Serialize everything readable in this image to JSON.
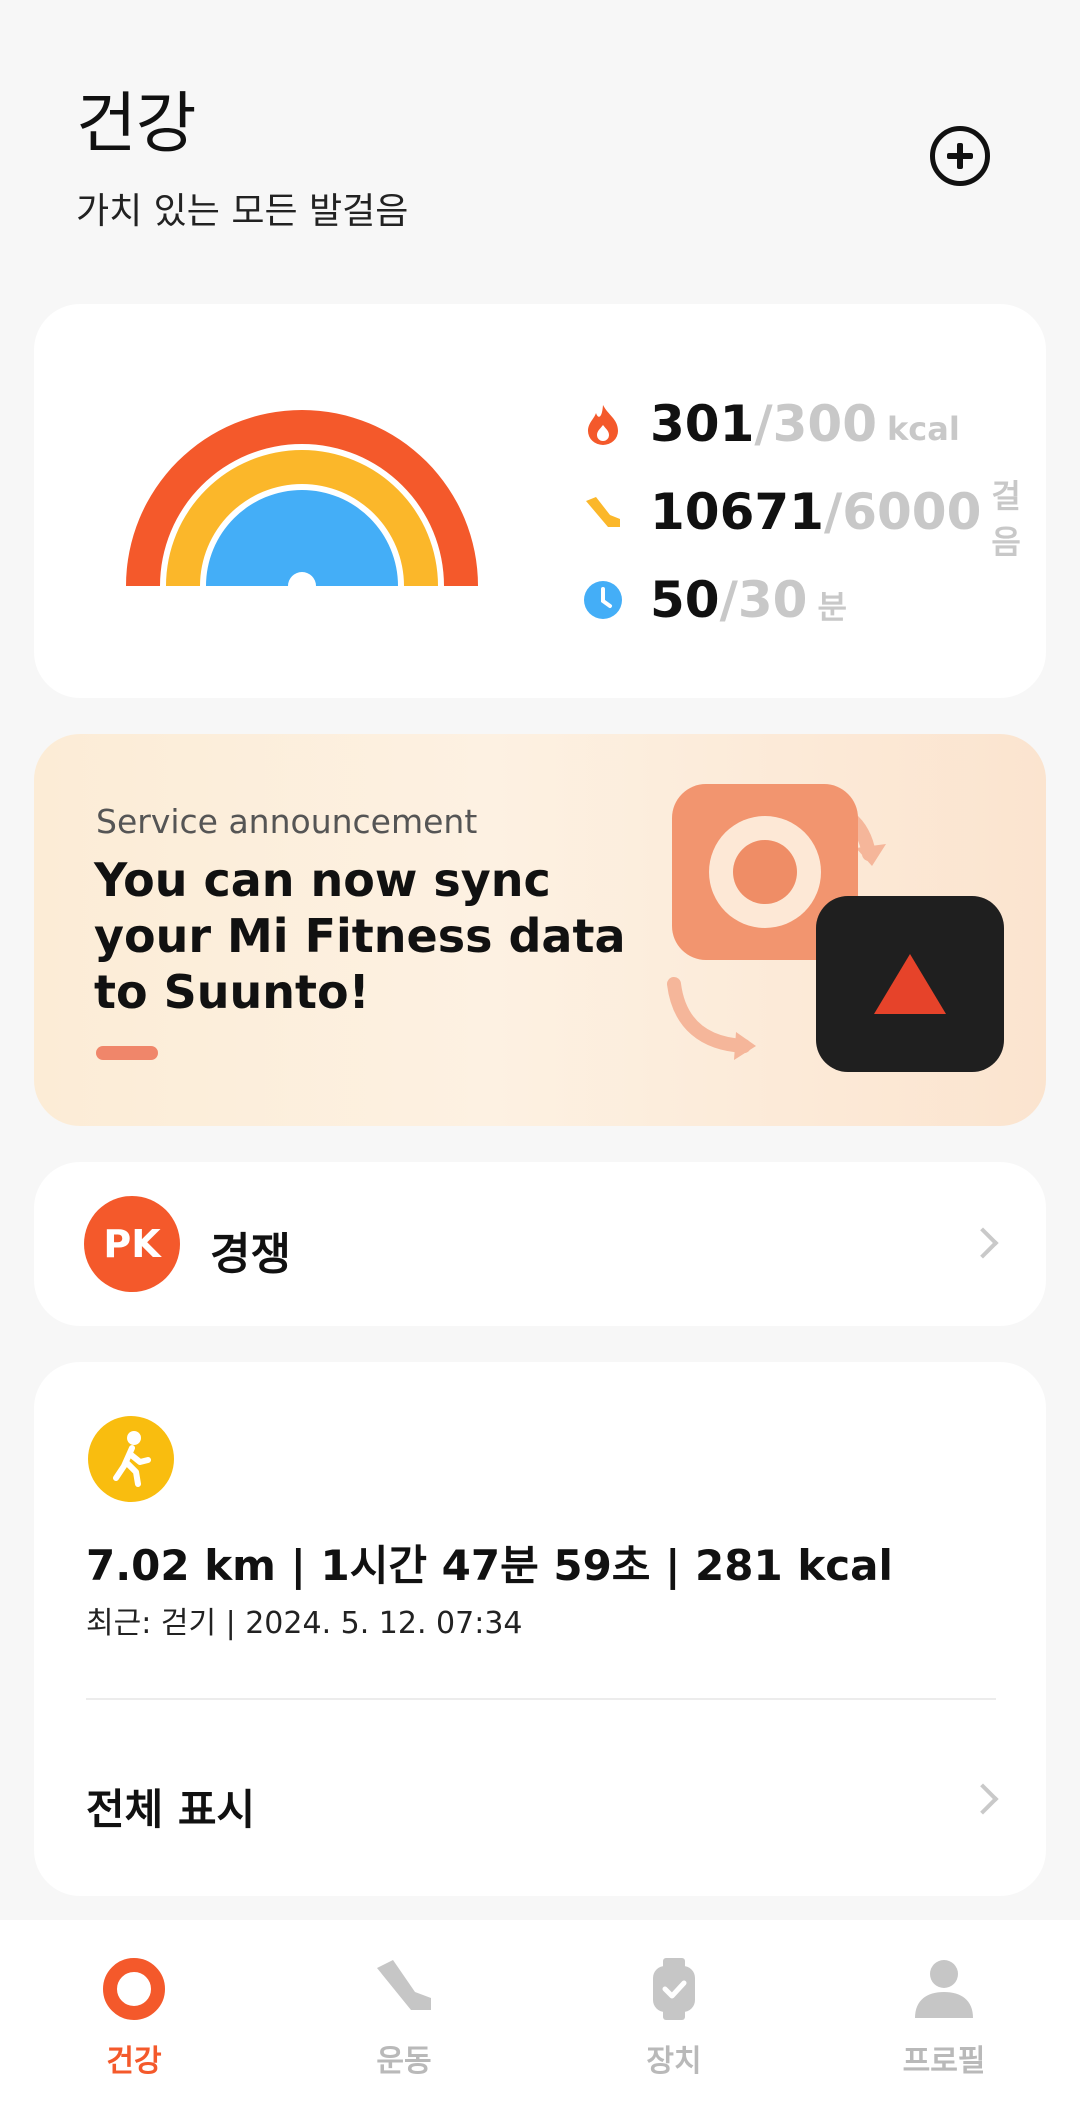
{
  "header": {
    "title": "건강",
    "subtitle": "가치 있는 모든 발걸음",
    "add_icon": "plus-circle-icon"
  },
  "activity_rings": {
    "colors": {
      "calories": "#f4592b",
      "steps": "#fbb72a",
      "duration": "#44aef7"
    },
    "metrics": [
      {
        "name": "calories",
        "icon": "flame-icon",
        "current": "301",
        "goal": "300",
        "unit": "kcal",
        "progress": 1.0
      },
      {
        "name": "steps",
        "icon": "shoe-icon",
        "current": "10671",
        "goal": "6000",
        "unit": "걸음",
        "progress": 1.0
      },
      {
        "name": "duration",
        "icon": "clock-icon",
        "current": "50",
        "goal": "30",
        "unit": "분",
        "progress": 1.0
      }
    ]
  },
  "banner": {
    "kicker": "Service announcement",
    "headline": "You can now sync your Mi Fitness data to Suunto!"
  },
  "competition": {
    "badge": "PK",
    "label": "경쟁"
  },
  "recent_activity": {
    "icon": "walking-icon",
    "summary": "7.02 km | 1시간 47분 59초 | 281 kcal",
    "recent": "최근: 걷기 | 2024. 5. 12. 07:34",
    "show_all": "전체 표시"
  },
  "tabs": [
    {
      "label": "건강",
      "icon": "health-ring-icon",
      "active": true
    },
    {
      "label": "운동",
      "icon": "shoe-icon",
      "active": false
    },
    {
      "label": "장치",
      "icon": "watch-icon",
      "active": false
    },
    {
      "label": "프로필",
      "icon": "person-icon",
      "active": false
    }
  ],
  "accent_color": "#f4592b"
}
